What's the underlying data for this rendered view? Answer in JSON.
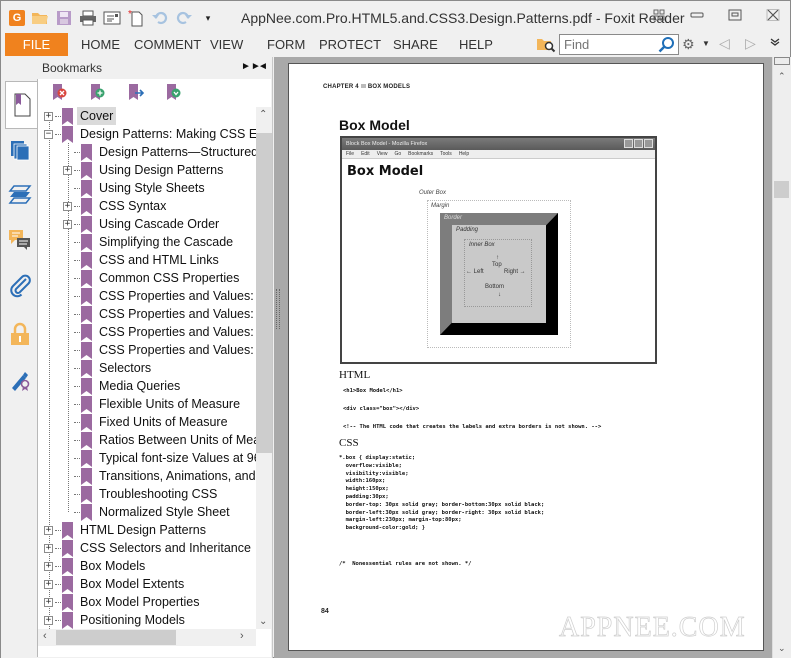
{
  "window": {
    "title": "AppNee.com.Pro.HTML5.and.CSS3.Design.Patterns.pdf - Foxit Reader",
    "controls": [
      "fullscreen-icon",
      "minimize-icon",
      "restore-icon",
      "close-icon"
    ]
  },
  "quick_access": {
    "logo": "G",
    "icons": [
      "open-folder-icon",
      "save-icon",
      "print-icon",
      "email-icon",
      "new-document-icon",
      "undo-icon",
      "redo-icon",
      "customize-dropdown-icon"
    ]
  },
  "ribbon": {
    "file_label": "FILE",
    "tabs": [
      "HOME",
      "COMMENT",
      "VIEW",
      "FORM",
      "PROTECT",
      "SHARE",
      "HELP"
    ],
    "find_placeholder": "Find",
    "accent_color": "#f0821e"
  },
  "panel": {
    "title": "Bookmarks",
    "side_tabs": [
      "bookmarks",
      "pages",
      "layers",
      "comments",
      "attachments",
      "security",
      "signatures"
    ],
    "toolbar": [
      "delete-bookmark",
      "add-bookmark",
      "go-to-bookmark",
      "expand-bookmark"
    ],
    "tree": [
      {
        "label": "Cover",
        "level": 0,
        "expander": "+",
        "selected": true
      },
      {
        "label": "Design Patterns: Making CSS Ea",
        "level": 0,
        "expander": "-"
      },
      {
        "label": "Design Patterns—Structured",
        "level": 1,
        "expander": ""
      },
      {
        "label": "Using Design Patterns",
        "level": 1,
        "expander": "+"
      },
      {
        "label": "Using Style Sheets",
        "level": 1,
        "expander": ""
      },
      {
        "label": "CSS Syntax",
        "level": 1,
        "expander": "+"
      },
      {
        "label": "Using Cascade Order",
        "level": 1,
        "expander": "+"
      },
      {
        "label": "Simplifying the Cascade",
        "level": 1,
        "expander": ""
      },
      {
        "label": "CSS and HTML Links",
        "level": 1,
        "expander": ""
      },
      {
        "label": "Common CSS Properties",
        "level": 1,
        "expander": ""
      },
      {
        "label": "CSS Properties and Values: C",
        "level": 1,
        "expander": ""
      },
      {
        "label": "CSS Properties and Values: C",
        "level": 1,
        "expander": ""
      },
      {
        "label": "CSS Properties and Values: L",
        "level": 1,
        "expander": ""
      },
      {
        "label": "CSS Properties and Values: S",
        "level": 1,
        "expander": ""
      },
      {
        "label": "Selectors",
        "level": 1,
        "expander": ""
      },
      {
        "label": "Media Queries",
        "level": 1,
        "expander": ""
      },
      {
        "label": "Flexible Units of Measure",
        "level": 1,
        "expander": ""
      },
      {
        "label": "Fixed Units of Measure",
        "level": 1,
        "expander": ""
      },
      {
        "label": "Ratios Between Units of Mea",
        "level": 1,
        "expander": ""
      },
      {
        "label": "Typical font-size Values at 96",
        "level": 1,
        "expander": ""
      },
      {
        "label": "Transitions, Animations, and",
        "level": 1,
        "expander": ""
      },
      {
        "label": "Troubleshooting CSS",
        "level": 1,
        "expander": ""
      },
      {
        "label": "Normalized Style Sheet",
        "level": 1,
        "expander": ""
      },
      {
        "label": "HTML Design Patterns",
        "level": 0,
        "expander": "+"
      },
      {
        "label": "CSS Selectors and Inheritance",
        "level": 0,
        "expander": "+"
      },
      {
        "label": "Box Models",
        "level": 0,
        "expander": "+"
      },
      {
        "label": "Box Model Extents",
        "level": 0,
        "expander": "+"
      },
      {
        "label": "Box Model Properties",
        "level": 0,
        "expander": "+"
      },
      {
        "label": "Positioning Models",
        "level": 0,
        "expander": "+"
      }
    ],
    "bookmark_color": "#9b6aa0"
  },
  "page": {
    "chapter": "CHAPTER 4",
    "chapter_section": "BOX MODELS",
    "heading": "Box Model",
    "figure": {
      "window_title": "Block Box Model - Mozilla Firefox",
      "menu": [
        "File",
        "Edit",
        "View",
        "Go",
        "Bookmarks",
        "Tools",
        "Help"
      ],
      "h1": "Box Model",
      "outer_box": "Outer Box",
      "margin": "Margin",
      "border": "Border",
      "padding": "Padding",
      "inner_box": "Inner Box",
      "top": "Top",
      "left": "← Left",
      "right": "Right →",
      "bottom": "Bottom",
      "up_arrow": "↑",
      "down_arrow": "↓"
    },
    "html_heading": "HTML",
    "html_code": [
      "<h1>Box Model</h1>",
      "<div class=\"box\"></div>",
      "<!-- The HTML code that creates the labels and extra borders is not shown. -->"
    ],
    "css_heading": "CSS",
    "css_code": "*.box { display:static;\n  overflow:visible;\n  visibility:visible;\n  width:160px;\n  height:150px;\n  padding:30px;\n  border-top: 30px solid gray; border-bottom:30px solid black;\n  border-left:30px solid gray; border-right: 30px solid black;\n  margin-left:230px; margin-top:80px;\n  background-color:gold; }",
    "css_note": "/*  Nonessential rules are not shown. */",
    "page_number": "84",
    "watermark": "APPNEE.COM"
  }
}
